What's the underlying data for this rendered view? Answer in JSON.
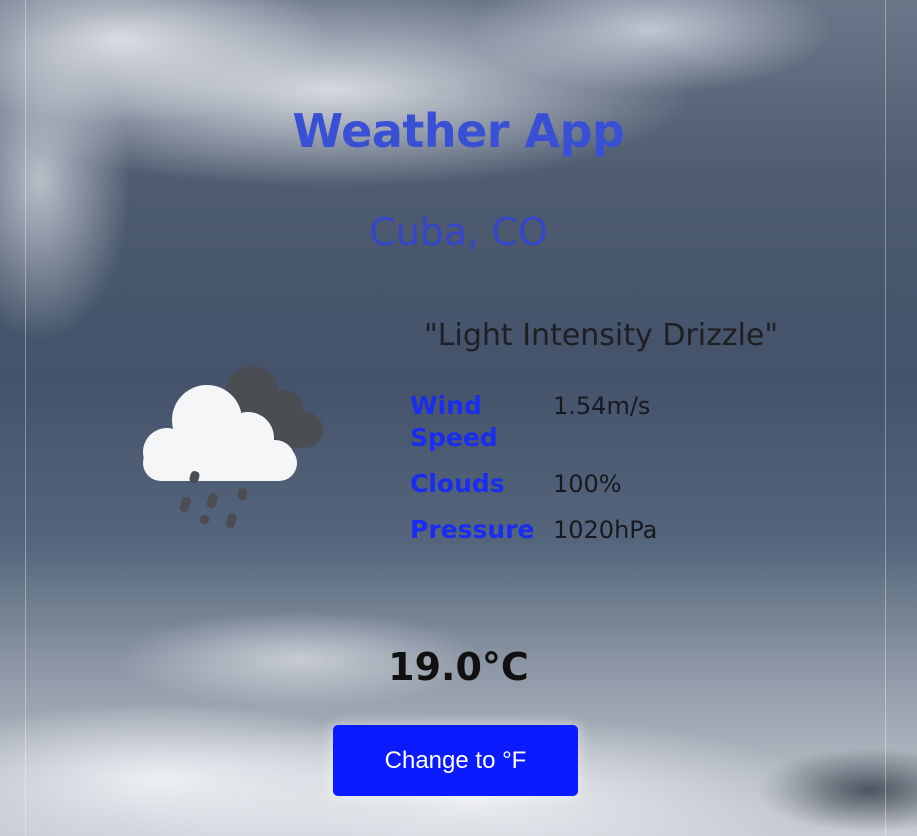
{
  "app": {
    "title": "Weather App"
  },
  "location": {
    "city": "Cuba, CO"
  },
  "weather": {
    "description": "\"Light Intensity Drizzle\"",
    "icon": "drizzle-cloud-icon",
    "details": [
      {
        "label": "Wind Speed",
        "value": "1.54m/s"
      },
      {
        "label": "Clouds",
        "value": "100%"
      },
      {
        "label": "Pressure",
        "value": "1020hPa"
      }
    ],
    "temperature": "19.0°C"
  },
  "controls": {
    "toggle_unit_label": "Change to °F"
  },
  "colors": {
    "title": "#3a50d4",
    "label_blue": "#1a2cf0",
    "button_blue": "#0a1bff"
  }
}
